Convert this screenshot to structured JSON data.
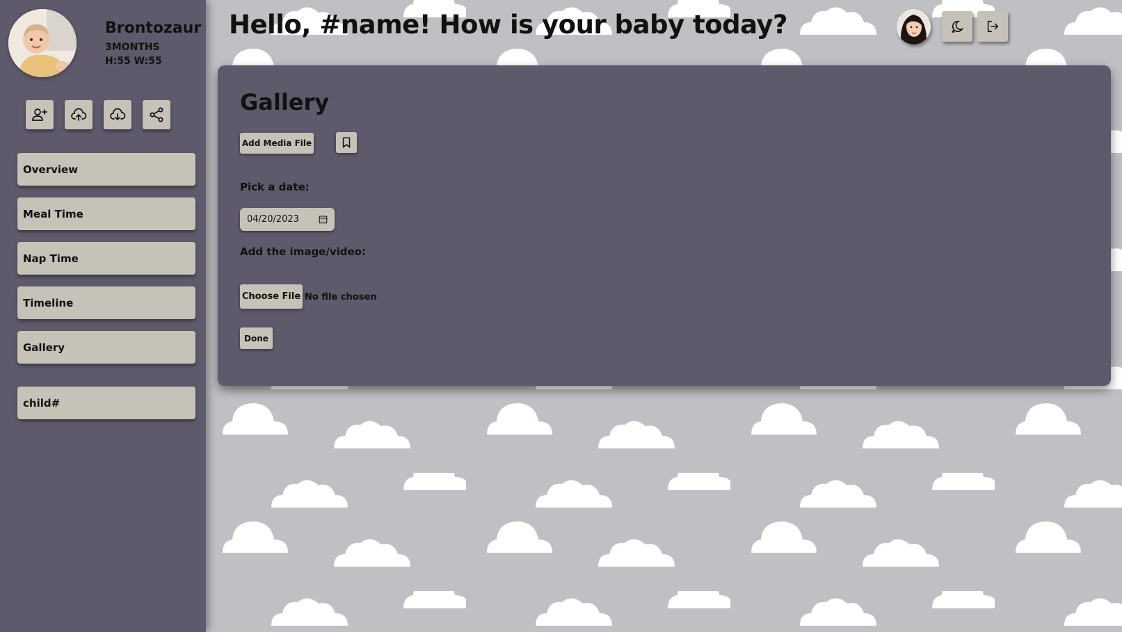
{
  "sidebar": {
    "baby": {
      "name": "Brontozaur",
      "age": "3MONTHS",
      "hw": "H:55 W:55"
    },
    "actions": [
      {
        "icon": "add-user-icon"
      },
      {
        "icon": "cloud-upload-icon"
      },
      {
        "icon": "cloud-download-icon"
      },
      {
        "icon": "share-icon"
      }
    ],
    "nav": [
      "Overview",
      "Meal Time",
      "Nap Time",
      "Timeline",
      "Gallery"
    ],
    "child_button": "child#"
  },
  "header": {
    "greeting": "Hello, #name! How is your baby today?",
    "buttons": [
      {
        "icon": "moon-icon"
      },
      {
        "icon": "logout-icon"
      }
    ]
  },
  "gallery": {
    "title": "Gallery",
    "add_media_label": "Add Media File",
    "bookmark_icon": "bookmark-icon",
    "date_label": "Pick a date:",
    "date_value": "04/20/2023",
    "file_label": "Add the image/video:",
    "choose_file_label": "Choose File",
    "no_file_text": "No file chosen",
    "done_label": "Done"
  },
  "colors": {
    "sidebar_bg": "#5e5a6c",
    "panel_bg": "#5e5a6c",
    "button_bg": "#c6c2b8",
    "page_bg": "#c0bfc3",
    "cloud": "#ffffff"
  }
}
